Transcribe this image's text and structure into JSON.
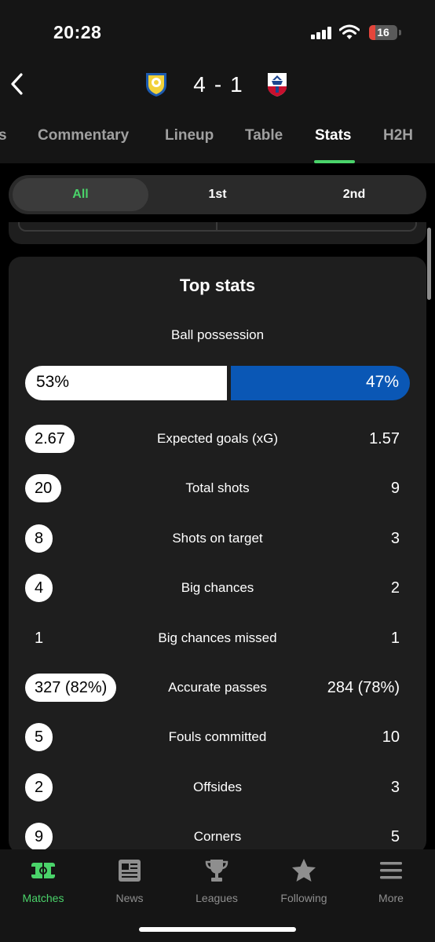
{
  "status_bar": {
    "time": "20:28",
    "battery": "16"
  },
  "match": {
    "home_score": "4",
    "separator": "-",
    "away_score": "1"
  },
  "tabs": [
    "s",
    "Commentary",
    "Lineup",
    "Table",
    "Stats",
    "H2H"
  ],
  "active_tab": "Stats",
  "period": {
    "options": [
      "All",
      "1st",
      "2nd"
    ],
    "selected": "All"
  },
  "top_stats": {
    "title": "Top stats",
    "possession": {
      "label": "Ball possession",
      "home": "53%",
      "away": "47%",
      "home_fraction": 0.53,
      "away_fraction": 0.47
    },
    "rows": [
      {
        "label": "Expected goals (xG)",
        "home": "2.67",
        "away": "1.57",
        "home_highlight": true
      },
      {
        "label": "Total shots",
        "home": "20",
        "away": "9",
        "home_highlight": true
      },
      {
        "label": "Shots on target",
        "home": "8",
        "away": "3",
        "home_highlight": true
      },
      {
        "label": "Big chances",
        "home": "4",
        "away": "2",
        "home_highlight": true
      },
      {
        "label": "Big chances missed",
        "home": "1",
        "away": "1",
        "home_highlight": false
      },
      {
        "label": "Accurate passes",
        "home": "327 (82%)",
        "away": "284 (78%)",
        "home_highlight": true
      },
      {
        "label": "Fouls committed",
        "home": "5",
        "away": "10",
        "home_highlight": true
      },
      {
        "label": "Offsides",
        "home": "2",
        "away": "3",
        "home_highlight": true
      },
      {
        "label": "Corners",
        "home": "9",
        "away": "5",
        "home_highlight": true
      }
    ]
  },
  "bottom_nav": [
    {
      "label": "Matches",
      "icon": "pitch-icon",
      "active": true
    },
    {
      "label": "News",
      "icon": "newspaper-icon",
      "active": false
    },
    {
      "label": "Leagues",
      "icon": "trophy-icon",
      "active": false
    },
    {
      "label": "Following",
      "icon": "star-icon",
      "active": false
    },
    {
      "label": "More",
      "icon": "menu-icon",
      "active": false
    }
  ],
  "colors": {
    "accent": "#4ad36a",
    "away_team": "#0a57b5",
    "card": "#1e1e1e"
  }
}
